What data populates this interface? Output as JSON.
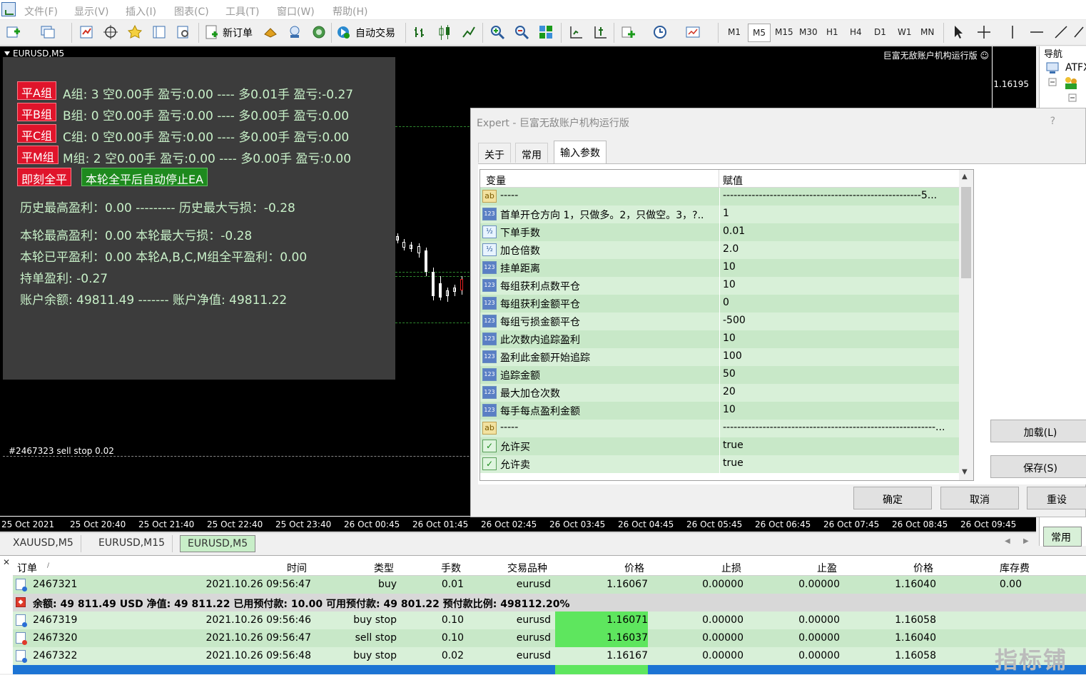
{
  "menubar": {
    "items": [
      "文件(F)",
      "显示(V)",
      "插入(I)",
      "图表(C)",
      "工具(T)",
      "窗口(W)",
      "帮助(H)"
    ]
  },
  "toolbar": {
    "new_order": "新订单",
    "auto_trade": "自动交易",
    "timeframes": [
      "M1",
      "M5",
      "M15",
      "M30",
      "H1",
      "H4",
      "D1",
      "W1",
      "MN"
    ],
    "active_timeframe": "M5"
  },
  "chart": {
    "title": "EURUSD,M5",
    "right_label": "巨富无敌账户机构运行版 ☺",
    "price_label": "1.16195",
    "order_label": "#2467323 sell stop 0.02",
    "time_labels": [
      "25 Oct 2021",
      "25 Oct 20:40",
      "25 Oct 21:40",
      "25 Oct 22:40",
      "25 Oct 23:40",
      "26 Oct 00:45",
      "26 Oct 01:45",
      "26 Oct 02:45",
      "26 Oct 03:45",
      "26 Oct 04:45",
      "26 Oct 05:45",
      "26 Oct 06:45",
      "26 Oct 07:45",
      "26 Oct 08:45",
      "26 Oct 09:45"
    ]
  },
  "ea_panel": {
    "groups": [
      {
        "button": "平A组",
        "text": "A组: 3  空0.00手  盈亏:0.00  ----  多0.01手   盈亏:-0.27"
      },
      {
        "button": "平B组",
        "text": "B组: 0  空0.00手  盈亏:0.00  ----  多0.00手   盈亏:0.00"
      },
      {
        "button": "平C组",
        "text": "C组: 0  空0.00手  盈亏:0.00  ----  多0.00手   盈亏:0.00"
      },
      {
        "button": "平M组",
        "text": "M组: 2  空0.00手  盈亏:0.00  ----  多0.00手   盈亏:0.00"
      }
    ],
    "close_all_button": "即刻全平",
    "auto_stop_button": "本轮全平后自动停止EA",
    "lines": [
      "历史最高盈利：0.00   ---------  历史最大亏损：-0.28",
      "本轮最高盈利：0.00    本轮最大亏损：-0.28",
      "本轮已平盈利：0.00    本轮A,B,C,M组全平盈利：0.00",
      "持单盈利: -0.27",
      "账户余额: 49811.49   -------  账户净值: 49811.22"
    ]
  },
  "navigator": {
    "title": "导航",
    "item": "ATFX",
    "tab": "常用"
  },
  "dialog": {
    "title": "Expert - 巨富无敌账户机构运行版",
    "help": "?",
    "tabs": [
      "关于",
      "常用",
      "输入参数"
    ],
    "active_tab": "输入参数",
    "col_variable": "变量",
    "col_value": "赋值",
    "params": [
      {
        "icon": "ab",
        "name": "-----",
        "value": "-------------------------------------------------------5..."
      },
      {
        "icon": "123",
        "name": "首单开仓方向 1，只做多。2，只做空。3，?..",
        "value": "1"
      },
      {
        "icon": "half",
        "name": "下单手数",
        "value": "0.01"
      },
      {
        "icon": "half",
        "name": "加仓倍数",
        "value": "2.0"
      },
      {
        "icon": "123",
        "name": "挂单距离",
        "value": "10"
      },
      {
        "icon": "123",
        "name": "每组获利点数平仓",
        "value": "10"
      },
      {
        "icon": "123",
        "name": "每组获利金额平仓",
        "value": "0"
      },
      {
        "icon": "123",
        "name": "每组亏损金额平仓",
        "value": "-500"
      },
      {
        "icon": "123",
        "name": "此次数内追踪盈利",
        "value": "10"
      },
      {
        "icon": "123",
        "name": "盈利此金额开始追踪",
        "value": "100"
      },
      {
        "icon": "123",
        "name": "追踪金额",
        "value": "50"
      },
      {
        "icon": "123",
        "name": "最大加仓次数",
        "value": "20"
      },
      {
        "icon": "123",
        "name": "每手每点盈利金额",
        "value": "10"
      },
      {
        "icon": "ab",
        "name": "-----",
        "value": "-----------------------------------------------------------..."
      },
      {
        "icon": "bool",
        "name": "允许买",
        "value": "true"
      },
      {
        "icon": "bool",
        "name": "允许卖",
        "value": "true"
      }
    ],
    "load_button": "加载(L)",
    "save_button": "保存(S)",
    "ok_button": "确定",
    "cancel_button": "取消",
    "reset_button": "重设"
  },
  "chart_tabs": [
    "XAUUSD,M5",
    "EURUSD,M15",
    "EURUSD,M5"
  ],
  "active_chart_tab": "EURUSD,M5",
  "terminal": {
    "headers": [
      "订单",
      "时间",
      "类型",
      "手数",
      "交易品种",
      "价格",
      "止损",
      "止盈",
      "价格",
      "库存费"
    ],
    "rows": [
      {
        "icon": "buy",
        "order": "2467321",
        "time": "2021.10.26 09:56:47",
        "type": "buy",
        "lots": "0.01",
        "symbol": "eurusd",
        "price": "1.16067",
        "sl": "0.00000",
        "tp": "0.00000",
        "cur": "1.16040",
        "swap": "0.00",
        "hl": false
      },
      {
        "icon": "buy",
        "order": "2467319",
        "time": "2021.10.26 09:56:46",
        "type": "buy stop",
        "lots": "0.10",
        "symbol": "eurusd",
        "price": "1.16071",
        "sl": "0.00000",
        "tp": "0.00000",
        "cur": "1.16058",
        "swap": "",
        "hl": true
      },
      {
        "icon": "sell",
        "order": "2467320",
        "time": "2021.10.26 09:56:47",
        "type": "sell stop",
        "lots": "0.10",
        "symbol": "eurusd",
        "price": "1.16037",
        "sl": "0.00000",
        "tp": "0.00000",
        "cur": "1.16040",
        "swap": "",
        "hl": true
      },
      {
        "icon": "buy",
        "order": "2467322",
        "time": "2021.10.26 09:56:48",
        "type": "buy stop",
        "lots": "0.02",
        "symbol": "eurusd",
        "price": "1.16167",
        "sl": "0.00000",
        "tp": "0.00000",
        "cur": "1.16058",
        "swap": "",
        "hl": false
      }
    ],
    "balance_line": "余额: 49 811.49 USD  净值: 49 811.22  已用预付款: 10.00  可用预付款: 49 801.22  预付款比例: 498112.20%"
  },
  "watermark": "指标铺"
}
